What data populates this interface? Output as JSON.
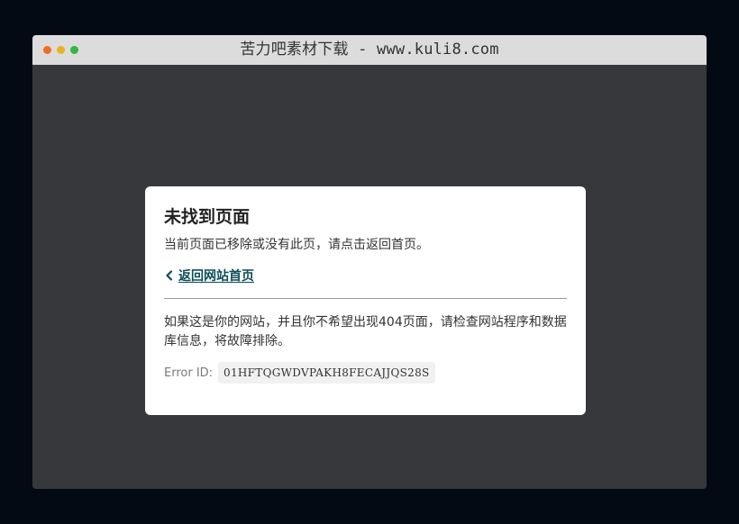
{
  "window": {
    "title": "苦力吧素材下载 - www.kuli8.com",
    "controls": [
      {
        "name": "close",
        "color": "#f26c21"
      },
      {
        "name": "minimize",
        "color": "#e8b31b"
      },
      {
        "name": "maximize",
        "color": "#37b441"
      }
    ]
  },
  "error_page": {
    "heading": "未找到页面",
    "description": "当前页面已移除或没有此页，请点击返回首页。",
    "back_link": {
      "label": "返回网站首页",
      "icon": "chevron-left-icon"
    },
    "owner_note": "如果这是你的网站，并且你不希望出现404页面，请检查网站程序和数据库信息，将故障排除。",
    "error_id_label": "Error ID:",
    "error_id_value": "01HFTQGWDVPAKH8FECAJJQS28S"
  },
  "colors": {
    "page_background": "#040a14",
    "viewport_background": "#36383c",
    "titlebar_background": "#dcdcdc",
    "card_background": "#ffffff",
    "link_color": "#0b4d5a"
  }
}
